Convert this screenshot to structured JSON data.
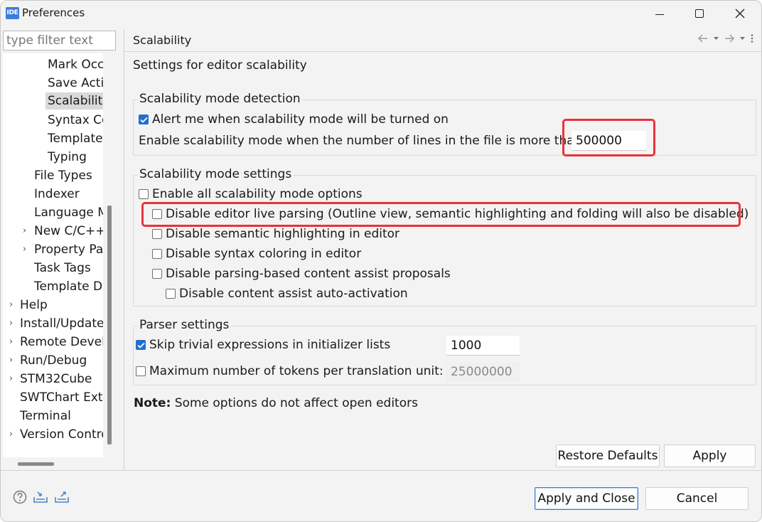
{
  "window": {
    "app_icon_text": "IDE",
    "title": "Preferences"
  },
  "sidebar": {
    "filter_placeholder": "type filter text",
    "items": [
      {
        "label": "Mark Occ",
        "expandable": false
      },
      {
        "label": "Save Acti",
        "expandable": false
      },
      {
        "label": "Scalability",
        "expandable": false,
        "selected": true
      },
      {
        "label": "Syntax Co",
        "expandable": false
      },
      {
        "label": "Template",
        "expandable": false
      },
      {
        "label": "Typing",
        "expandable": false
      },
      {
        "label": "File Types",
        "expandable": false
      },
      {
        "label": "Indexer",
        "expandable": false
      },
      {
        "label": "Language M",
        "expandable": false
      },
      {
        "label": "New C/C++",
        "expandable": true
      },
      {
        "label": "Property Pa",
        "expandable": true
      },
      {
        "label": "Task Tags",
        "expandable": false
      },
      {
        "label": "Template D",
        "expandable": false
      },
      {
        "label": "Help",
        "expandable": true
      },
      {
        "label": "Install/Update",
        "expandable": true
      },
      {
        "label": "Remote Devel",
        "expandable": true
      },
      {
        "label": "Run/Debug",
        "expandable": true
      },
      {
        "label": "STM32Cube",
        "expandable": true
      },
      {
        "label": "SWTChart Exte",
        "expandable": false
      },
      {
        "label": "Terminal",
        "expandable": false
      },
      {
        "label": "Version Contro",
        "expandable": true
      }
    ]
  },
  "page": {
    "title": "Scalability",
    "description": "Settings for editor scalability",
    "detection": {
      "group_label": "Scalability mode detection",
      "alert_label": "Alert me when scalability mode will be turned on",
      "alert_checked": true,
      "lines_label": "Enable scalability mode when the number of lines in the file is more than:",
      "lines_value": "500000"
    },
    "mode_settings": {
      "group_label": "Scalability mode settings",
      "options": [
        {
          "label": "Enable all scalability mode options",
          "checked": false
        },
        {
          "label": "Disable editor live parsing (Outline view, semantic highlighting and folding will also be disabled)",
          "checked": false
        },
        {
          "label": "Disable semantic highlighting in editor",
          "checked": false
        },
        {
          "label": "Disable syntax coloring in editor",
          "checked": false
        },
        {
          "label": "Disable parsing-based content assist proposals",
          "checked": false
        },
        {
          "label": "Disable content assist auto-activation",
          "checked": false
        }
      ]
    },
    "parser": {
      "group_label": "Parser settings",
      "skip_label": "Skip trivial expressions in initializer lists",
      "skip_checked": true,
      "skip_value": "1000",
      "max_tokens_label": "Maximum number of tokens per translation unit:",
      "max_tokens_checked": false,
      "max_tokens_value": "25000000"
    },
    "note_bold": "Note:",
    "note_text": " Some options do not affect open editors",
    "restore_defaults_label": "Restore Defaults",
    "apply_label": "Apply"
  },
  "footer": {
    "apply_close_label": "Apply and Close",
    "cancel_label": "Cancel",
    "icons": [
      "help-icon",
      "import-icon",
      "export-icon"
    ]
  },
  "colors": {
    "accent": "#1f6fd1",
    "highlight": "#e8333a"
  }
}
